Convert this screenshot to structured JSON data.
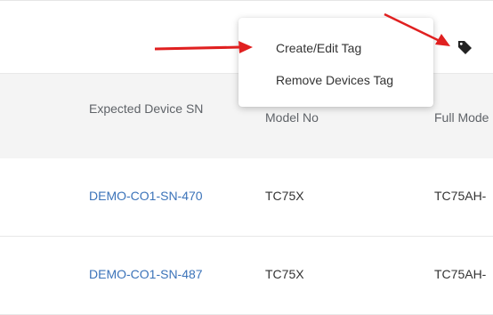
{
  "menu": {
    "items": [
      {
        "label": "Create/Edit Tag"
      },
      {
        "label": "Remove Devices Tag"
      }
    ]
  },
  "table": {
    "columns": [
      "Expected Device SN",
      "Model No",
      "Full Mode"
    ],
    "rows": [
      {
        "sn": "DEMO-CO1-SN-470",
        "model": "TC75X",
        "full": "TC75AH-"
      },
      {
        "sn": "DEMO-CO1-SN-487",
        "model": "TC75X",
        "full": "TC75AH-"
      }
    ]
  },
  "icons": {
    "tag": "tag-icon"
  },
  "colors": {
    "link": "#3b73b9",
    "header_bg": "#f4f4f4",
    "annotation_arrow": "#e02020"
  }
}
